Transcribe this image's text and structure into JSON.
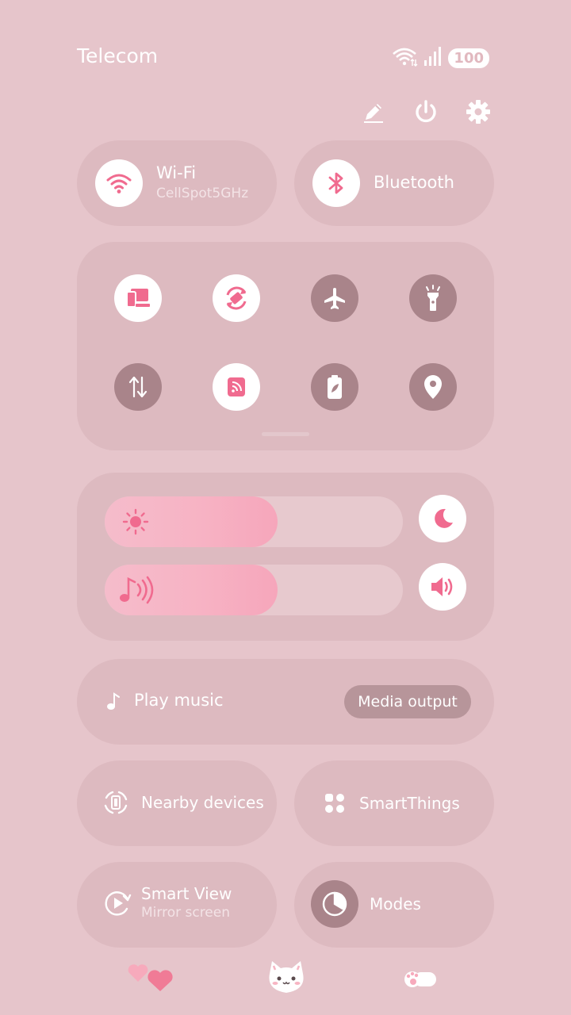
{
  "status_bar": {
    "carrier": "Telecom",
    "battery": "100",
    "icons": [
      "wifi-icon",
      "signal-icon",
      "battery-icon"
    ]
  },
  "top_actions": {
    "icons": [
      "edit-icon",
      "power-icon",
      "settings-icon"
    ]
  },
  "wifi": {
    "label": "Wi-Fi",
    "network": "CellSpot5GHz",
    "active": true
  },
  "bluetooth": {
    "label": "Bluetooth",
    "active": true
  },
  "quick_toggles": [
    {
      "icon": "screen-mirror-icon",
      "active": true
    },
    {
      "icon": "auto-rotate-icon",
      "active": true
    },
    {
      "icon": "airplane-icon",
      "active": false
    },
    {
      "icon": "flashlight-icon",
      "active": false
    },
    {
      "icon": "mobile-data-icon",
      "active": false
    },
    {
      "icon": "nfc-icon",
      "active": true
    },
    {
      "icon": "power-saving-icon",
      "active": false
    },
    {
      "icon": "location-icon",
      "active": false
    }
  ],
  "brightness": {
    "level": 0.58,
    "icon": "sun-icon",
    "side_icon": "moon-icon"
  },
  "volume": {
    "level": 0.58,
    "icon": "music-note-icon",
    "side_icon": "speaker-icon"
  },
  "media": {
    "label": "Play music",
    "output_button": "Media output"
  },
  "nearby": {
    "label": "Nearby devices"
  },
  "smartthings": {
    "label": "SmartThings"
  },
  "smart_view": {
    "label": "Smart View",
    "sub": "Mirror screen"
  },
  "modes": {
    "label": "Modes"
  },
  "colors": {
    "accent": "#f06b8f",
    "background": "#e6c5cb",
    "panel": "#ddbac0",
    "inactive": "#a9848a"
  },
  "decorations": [
    "hearts-sticker",
    "cat-face-sticker",
    "paw-sticker"
  ]
}
